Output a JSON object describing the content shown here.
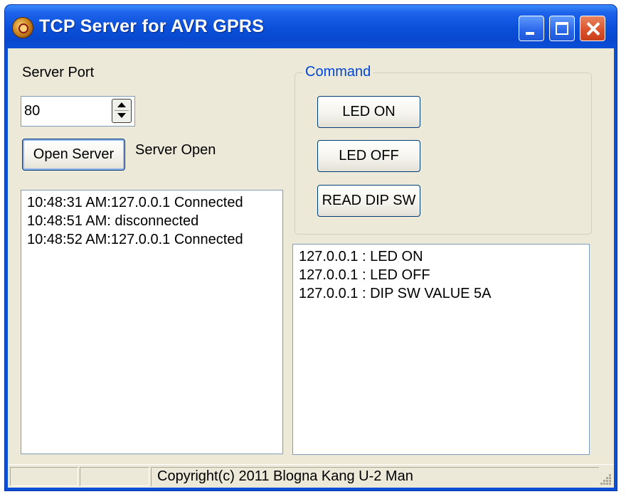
{
  "window": {
    "title": "TCP Server for AVR GPRS",
    "icons": {
      "app": "app-icon",
      "minimize": "minimize-icon",
      "maximize": "maximize-icon",
      "close": "close-icon"
    }
  },
  "server": {
    "port_label": "Server Port",
    "port_value": "80",
    "open_button": "Open Server",
    "status": "Server Open"
  },
  "connection_log": [
    "10:48:31 AM:127.0.0.1 Connected",
    "10:48:51 AM: disconnected",
    "10:48:52 AM:127.0.0.1 Connected"
  ],
  "command": {
    "title": "Command",
    "buttons": [
      "LED ON",
      "LED OFF",
      "READ DIP SW"
    ]
  },
  "message_log": [
    "127.0.0.1 : LED ON",
    "127.0.0.1 : LED OFF",
    "127.0.0.1 : DIP SW VALUE 5A"
  ],
  "statusbar": {
    "panels": [
      "",
      "",
      "Copyright(c) 2011 Blogna Kang U-2 Man"
    ]
  },
  "colors": {
    "titlebar": "#0b4fd6",
    "client_bg": "#ece9d8",
    "group_title": "#0046d5",
    "close_button": "#d9512a"
  }
}
